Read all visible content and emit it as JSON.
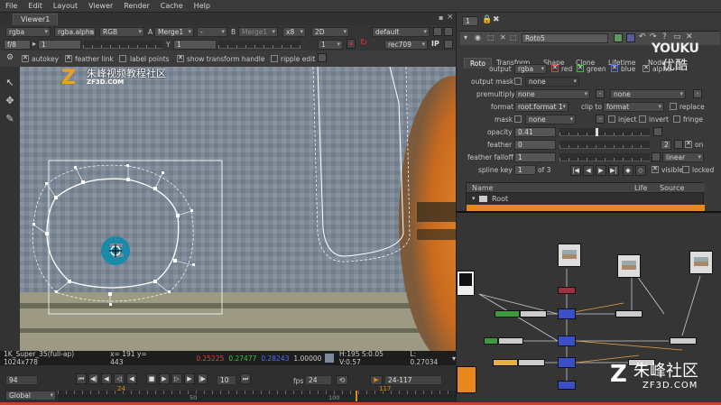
{
  "menu": [
    "File",
    "Edit",
    "Layout",
    "Viewer",
    "Render",
    "Cache",
    "Help"
  ],
  "viewer_tab": "Viewer1",
  "viewer_toolbar": {
    "channels": "rgba",
    "alpha": "rgba.alpha",
    "colorspace": "RGB",
    "a_label": "A",
    "a_input": "Merge1",
    "a_dash": "-",
    "b_label": "B",
    "b_input": "Merge1",
    "zoom": "x8",
    "mode": "2D",
    "lut": "default",
    "fstop": "f/8",
    "gain": "1",
    "y_label": "Y",
    "gamma": "1",
    "frame_step": "1",
    "view_lut": "rec709",
    "ip": "IP"
  },
  "roto_toolbar": {
    "autokey": "autokey",
    "feather_link": "feather link",
    "label_points": "label points",
    "show_transform_handle": "show transform handle",
    "ripple_edit": "ripple edit"
  },
  "watermark_left": {
    "text": "朱峰视频教程社区",
    "sub": "ZF3D.COM"
  },
  "watermark_right": {
    "text": "朱峰社区",
    "sub": "ZF3D.COM"
  },
  "youku": {
    "text": "YOUKU",
    "sub": "优酷"
  },
  "info_bar": {
    "format": "1K_Super_35(full-ap) 1024x778",
    "coords": "x= 191 y= 443",
    "r": "0.25225",
    "g": "0.27477",
    "b": "0.28243",
    "a": "1.00000",
    "hsv": "H:195 S:0.05 V:0.57",
    "l": "L: 0.27034"
  },
  "timeline": {
    "frame": "94",
    "fps_label": "fps",
    "fps": "24",
    "step": "10",
    "range": "24-117",
    "global": "Global",
    "start_marker": "24",
    "end_marker": "117",
    "ticks": [
      "50",
      "100"
    ]
  },
  "properties": {
    "count": "1",
    "node_name": "Roto5",
    "tabs": [
      "Roto",
      "Transform",
      "Shape",
      "Clone",
      "Lifetime",
      "Node"
    ],
    "output_label": "output",
    "output_value": "rgba",
    "channels": [
      "red",
      "green",
      "blue",
      "alpha"
    ],
    "output_mask_label": "output mask",
    "output_mask_value": "none",
    "premultiply_label": "premultiply",
    "premultiply_value": "none",
    "premultiply_value2": "none",
    "format_label": "format",
    "format_value": "root.format 1",
    "clip_to_label": "clip to",
    "clip_to_value": "format",
    "replace_label": "replace",
    "mask_label": "mask",
    "mask_value": "none",
    "inject_label": "inject",
    "invert_label": "invert",
    "fringe_label": "fringe",
    "opacity_label": "opacity",
    "opacity_value": "0.41",
    "opacity_fraction": 0.41,
    "feather_label": "feather",
    "feather_value": "0",
    "feather_count": "2",
    "on_label": "on",
    "feather_falloff_label": "feather falloff",
    "feather_falloff_value": "1",
    "falloff_type": "linear",
    "spline_key_label": "spline key",
    "spline_key_value": "1",
    "spline_key_of": "of 3",
    "visible_label": "visible",
    "locked_label": "locked",
    "tree_headers": [
      "Name",
      "Life",
      "Source"
    ],
    "tree_root": "Root",
    "slider_ticks": [
      "0",
      "0.1",
      "0.2",
      "0.3",
      "0.4",
      "0.5",
      "0.6",
      "0.7",
      "0.8",
      "0.9"
    ]
  },
  "colors": {
    "accent_orange": "#e8881a",
    "node_blue": "#3a4fc8",
    "node_green": "#3c9a3c",
    "node_red": "#a03040",
    "roto_white": "#ffffff",
    "keyed_cyan": "#1a8aaa"
  }
}
